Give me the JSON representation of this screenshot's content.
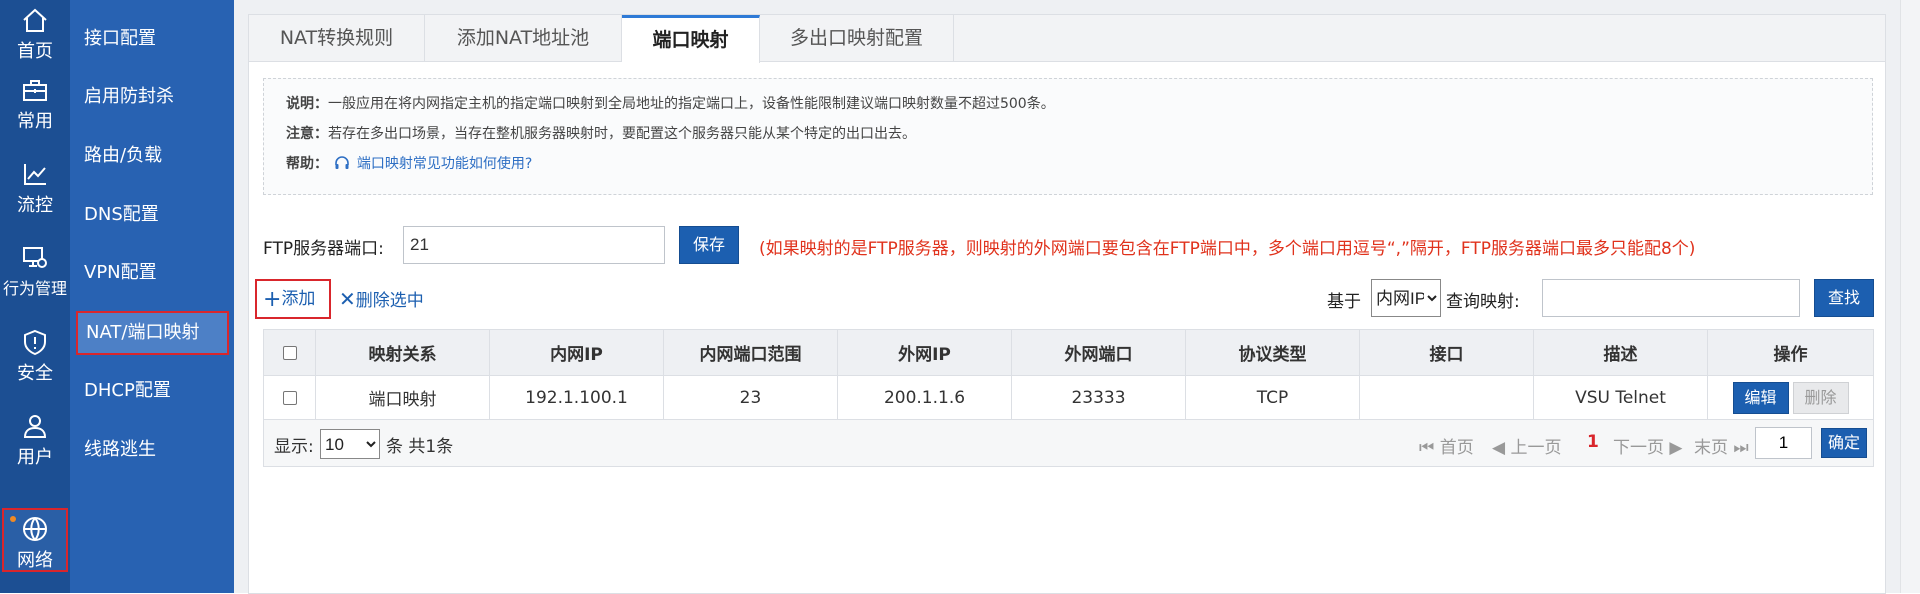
{
  "rail": {
    "items": [
      {
        "label": "首页",
        "icon": "home-icon"
      },
      {
        "label": "常用",
        "icon": "toolbox-icon"
      },
      {
        "label": "流控",
        "icon": "chart-icon"
      },
      {
        "label": "行为管理",
        "icon": "monitor-gear-icon"
      },
      {
        "label": "安全",
        "icon": "shield-icon"
      },
      {
        "label": "用户",
        "icon": "user-icon"
      },
      {
        "label": "网络",
        "icon": "network-globe-icon"
      }
    ],
    "active": "网络"
  },
  "menu": {
    "items": [
      "接口配置",
      "启用防封杀",
      "路由/负载",
      "DNS配置",
      "VPN配置",
      "NAT/端口映射",
      "DHCP配置",
      "线路逃生"
    ],
    "active": "NAT/端口映射"
  },
  "tabs": [
    "NAT转换规则",
    "添加NAT地址池",
    "端口映射",
    "多出口映射配置"
  ],
  "active_tab": "端口映射",
  "notice": {
    "desc_label": "说明：",
    "desc": "一般应用在将内网指定主机的指定端口映射到全局地址的指定端口上，设备性能限制建议端口映射数量不超过500条。",
    "note_label": "注意：",
    "note": "若存在多出口场景，当存在整机服务器映射时，要配置这个服务器只能从某个特定的出口出去。",
    "help_label": "帮助：",
    "help_link": "端口映射常见功能如何使用?"
  },
  "ftp": {
    "label": "FTP服务器端口:",
    "value": "21",
    "save": "保存",
    "tip": "(如果映射的是FTP服务器，则映射的外网端口要包含在FTP端口中，多个端口用逗号“,”隔开，FTP服务器端口最多只能配8个)"
  },
  "toolbar": {
    "add": "添加",
    "delete_selected": "删除选中",
    "based_on_label": "基于",
    "based_on_value": "内网IP",
    "query_label": "查询映射:",
    "query_value": "",
    "search": "查找"
  },
  "table": {
    "headers": [
      "映射关系",
      "内网IP",
      "内网端口范围",
      "外网IP",
      "外网端口",
      "协议类型",
      "接口",
      "描述",
      "操作"
    ],
    "rows": [
      {
        "relation": "端口映射",
        "inner_ip": "192.1.100.1",
        "inner_port": "23",
        "outer_ip": "200.1.1.6",
        "outer_port": "23333",
        "protocol": "TCP",
        "iface": "",
        "desc": "VSU Telnet",
        "edit": "编辑",
        "delete": "删除"
      }
    ]
  },
  "pager": {
    "show_label": "显示:",
    "page_size": "10",
    "total": "条 共1条",
    "first": "首页",
    "prev": "上一页",
    "current": "1",
    "next": "下一页",
    "last": "末页",
    "goto_value": "1",
    "confirm": "确定"
  },
  "colors": {
    "rail": "#1c4f93",
    "menu": "#2862b2",
    "accent": "#1c5fb0",
    "highlight": "#d9262c",
    "tip": "#e0321c"
  }
}
